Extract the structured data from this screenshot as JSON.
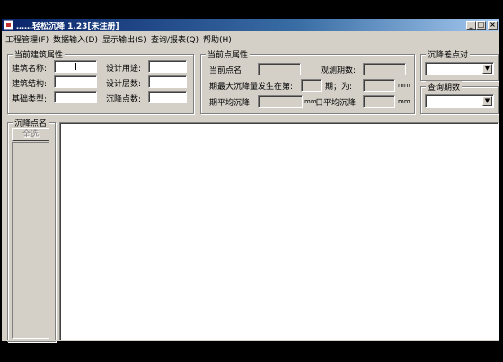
{
  "window": {
    "title": "……轻松沉降 1.23[未注册]",
    "buttons": {
      "minimize": "_",
      "maximize": "□",
      "close": "×"
    }
  },
  "menu": [
    {
      "label": "工程管理(F)"
    },
    {
      "label": "数据输入(D)"
    },
    {
      "label": "显示输出(S)"
    },
    {
      "label": "查询/报表(Q)"
    },
    {
      "label": "帮助(H)"
    }
  ],
  "building_props": {
    "title": "当前建筑属性",
    "labels": {
      "name": "建筑名称:",
      "usage": "设计用途:",
      "structure": "建筑结构:",
      "floors": "设计层数:",
      "foundation": "基础类型:",
      "points": "沉降点数:"
    }
  },
  "point_props": {
    "title": "当前点属性",
    "labels": {
      "point_name": "当前点名:",
      "obs_count": "观测期数:",
      "max_at": "期最大沉降量发生在第:",
      "period": "期；为:",
      "unit1": "mm",
      "avg": "期平均沉降:",
      "unit2": "mm",
      "daily_avg": "日平均沉降:",
      "unit3": "mm"
    }
  },
  "settle_diff": {
    "title": "沉降差点对",
    "value": ""
  },
  "query_period": {
    "title": "查询期数",
    "value": ""
  },
  "point_list": {
    "title": "沉降点名",
    "select_all": "全选"
  }
}
